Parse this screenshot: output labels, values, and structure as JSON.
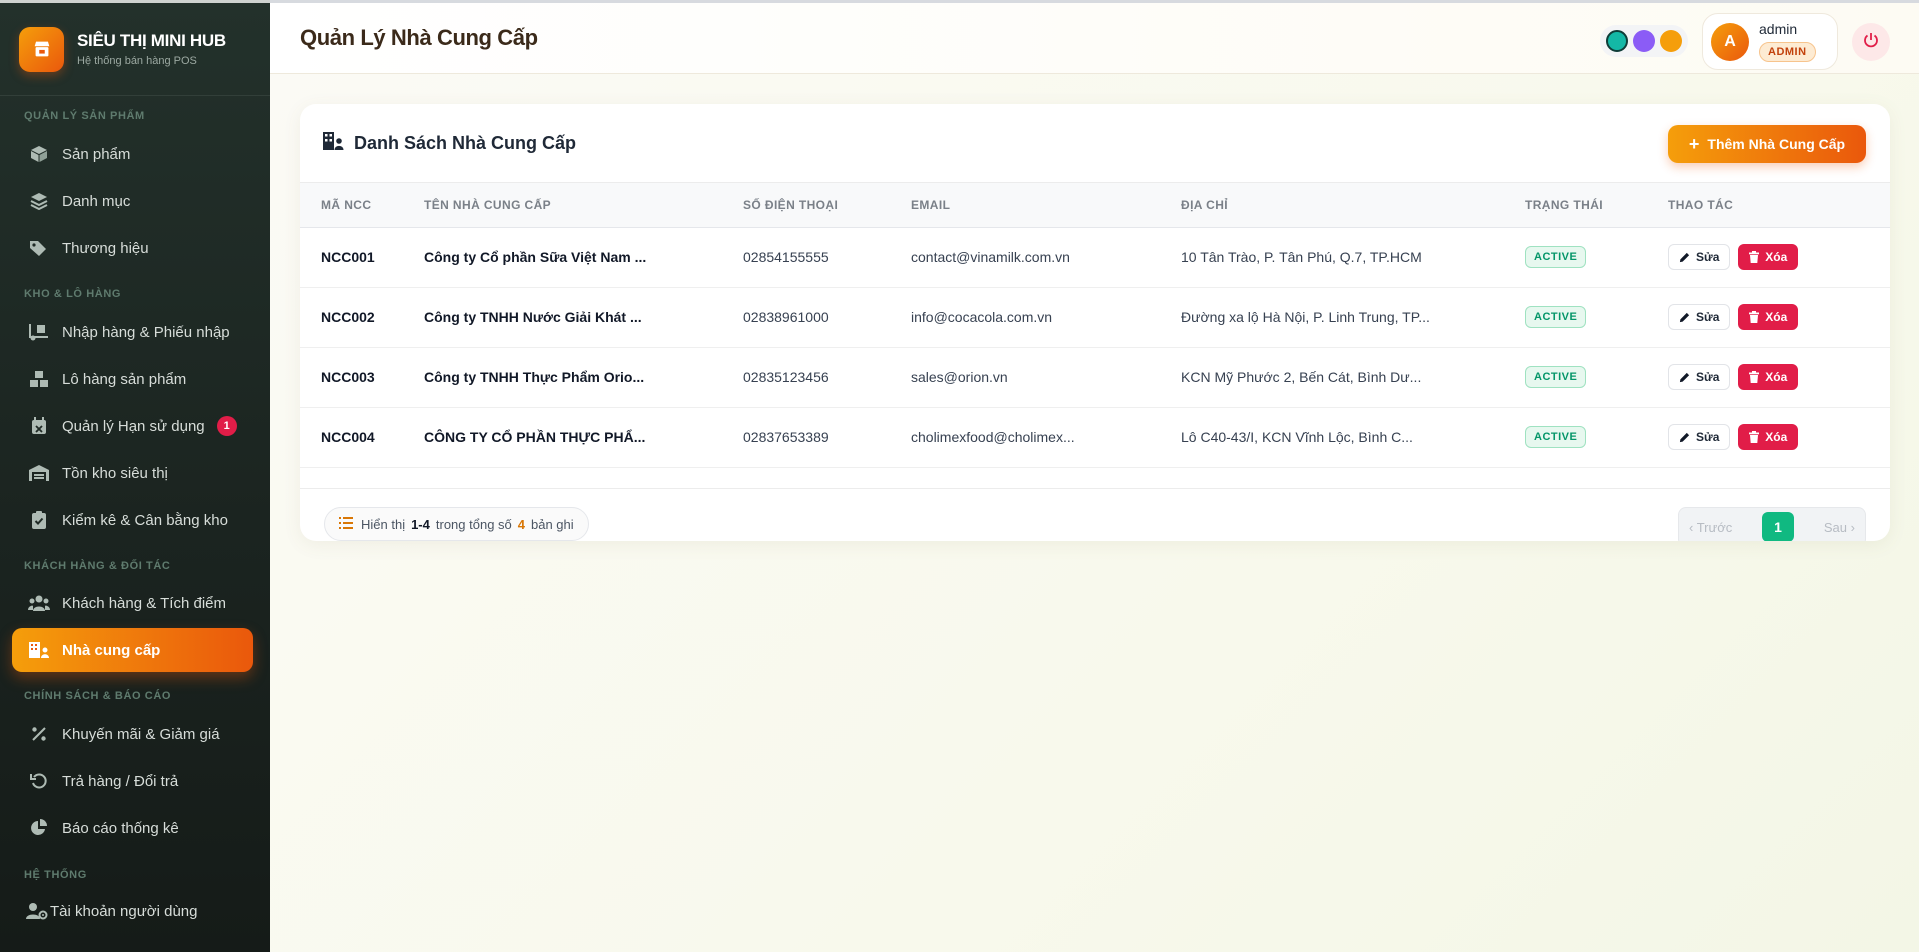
{
  "brand": {
    "title": "SIÊU THỊ MINI HUB",
    "subtitle": "Hệ thống bán hàng POS"
  },
  "sidebar": {
    "sections": [
      {
        "label": "QUẢN LÝ SẢN PHẨM"
      },
      {
        "label": "KHO & LÔ HÀNG"
      },
      {
        "label": "KHÁCH HÀNG & ĐỐI TÁC"
      },
      {
        "label": "CHÍNH SÁCH & BÁO CÁO"
      },
      {
        "label": "HỆ THỐNG"
      }
    ],
    "items": [
      {
        "label": "Sản phẩm",
        "icon": "box-icon"
      },
      {
        "label": "Danh mục",
        "icon": "layers-icon"
      },
      {
        "label": "Thương hiệu",
        "icon": "tags-icon"
      },
      {
        "label": "Nhập hàng & Phiếu nhập",
        "icon": "truck-loading-icon"
      },
      {
        "label": "Lô hàng sản phẩm",
        "icon": "boxes-icon"
      },
      {
        "label": "Quản lý Hạn sử dụng",
        "icon": "calendar-x-icon",
        "badge": "1"
      },
      {
        "label": "Tồn kho siêu thị",
        "icon": "warehouse-icon"
      },
      {
        "label": "Kiểm kê & Cân bằng kho",
        "icon": "clipboard-check-icon"
      },
      {
        "label": "Khách hàng & Tích điểm",
        "icon": "users-icon"
      },
      {
        "label": "Nhà cung cấp",
        "icon": "building-user-icon",
        "active": true
      },
      {
        "label": "Khuyến mãi & Giảm giá",
        "icon": "percent-icon"
      },
      {
        "label": "Trả hàng / Đổi trả",
        "icon": "undo-icon"
      },
      {
        "label": "Báo cáo thống kê",
        "icon": "pie-chart-icon"
      },
      {
        "label": "Tài khoản người dùng",
        "icon": "user-gear-icon"
      }
    ]
  },
  "header": {
    "title": "Quản Lý Nhà Cung Cấp",
    "theme_colors": [
      "#14b8a6",
      "#8b5cf6",
      "#f59e0b"
    ],
    "user": {
      "initial": "A",
      "name": "admin",
      "role": "ADMIN"
    }
  },
  "card": {
    "title": "Danh Sách Nhà Cung Cấp",
    "add_label": "Thêm Nhà Cung Cấp",
    "columns": [
      "MÃ NCC",
      "TÊN NHÀ CUNG CẤP",
      "SỐ ĐIỆN THOẠI",
      "EMAIL",
      "ĐỊA CHỈ",
      "TRẠNG THÁI",
      "THAO TÁC"
    ],
    "rows": [
      {
        "code": "NCC001",
        "name": "Công ty Cổ phần Sữa Việt Nam ...",
        "phone": "02854155555",
        "email": "contact@vinamilk.com.vn",
        "address": "10 Tân Trào, P. Tân Phú, Q.7, TP.HCM",
        "status": "ACTIVE"
      },
      {
        "code": "NCC002",
        "name": "Công ty TNHH Nước Giải Khát ...",
        "phone": "02838961000",
        "email": "info@cocacola.com.vn",
        "address": "Đường xa lộ Hà Nội, P. Linh Trung, TP...",
        "status": "ACTIVE"
      },
      {
        "code": "NCC003",
        "name": "Công ty TNHH Thực Phẩm Orio...",
        "phone": "02835123456",
        "email": "sales@orion.vn",
        "address": "KCN Mỹ Phước 2, Bến Cát, Bình Dư...",
        "status": "ACTIVE"
      },
      {
        "code": "NCC004",
        "name": "CÔNG TY CỔ PHẦN THỰC PHẨ...",
        "phone": "02837653389",
        "email": "cholimexfood@cholimex...",
        "address": "Lô C40-43/I, KCN Vĩnh Lộc, Bình C...",
        "status": "ACTIVE"
      }
    ],
    "edit_label": "Sửa",
    "delete_label": "Xóa",
    "footer": {
      "showing_prefix": "Hiển thị",
      "range": "1-4",
      "total_prefix": "trong tổng số",
      "total": "4",
      "total_suffix": "bản ghi"
    },
    "pagination": {
      "prev": "Trước",
      "current": "1",
      "next": "Sau"
    }
  }
}
